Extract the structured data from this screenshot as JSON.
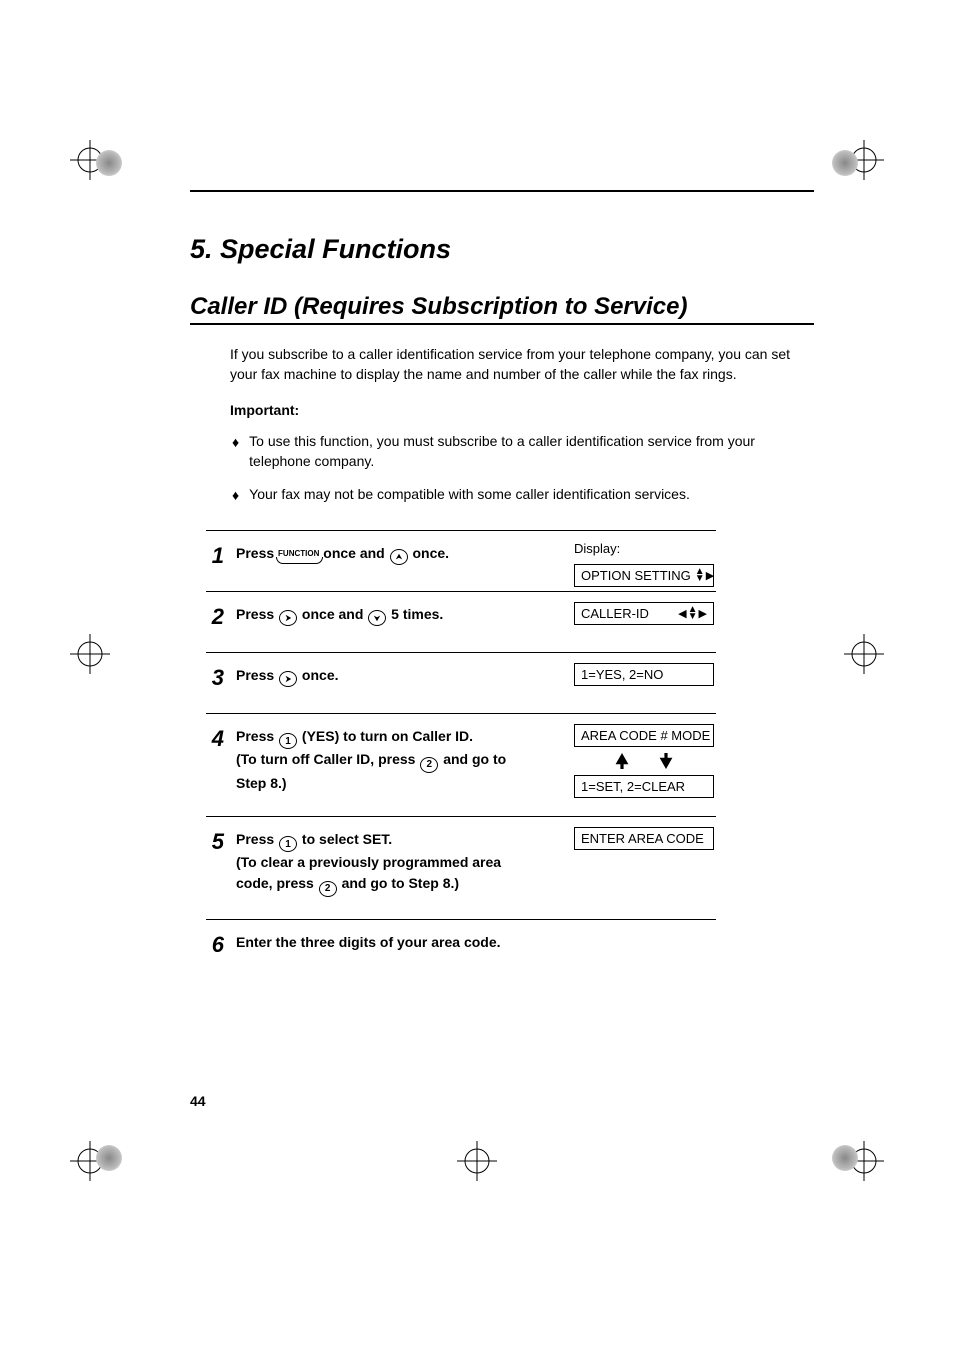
{
  "chapter": "5.  Special Functions",
  "section": "Caller ID (Requires Subscription to Service)",
  "intro": "If you subscribe to a caller identification service from your telephone company, you can set your fax machine to display the name and number of the caller while the fax rings.",
  "important_label": "Important:",
  "bullets": [
    "To use this function, you must subscribe to a caller identification service from your telephone company.",
    "Your fax may not be compatible with some caller identification services."
  ],
  "steps": [
    {
      "n": "1",
      "parts": [
        "Press ",
        "FUNCTION",
        " once and ",
        "UP_KEY",
        " once."
      ],
      "display_label": "Display:",
      "displays": [
        {
          "text": "OPTION SETTING",
          "arrows": "udr"
        }
      ]
    },
    {
      "n": "2",
      "parts": [
        "Press ",
        "RIGHT_KEY",
        " once and ",
        "DOWN_KEY",
        " 5 times."
      ],
      "displays": [
        {
          "text": "CALLER-ID",
          "arrows": "udlr"
        }
      ]
    },
    {
      "n": "3",
      "parts": [
        "Press ",
        "RIGHT_KEY",
        " once."
      ],
      "displays": [
        {
          "text": "1=YES, 2=NO"
        }
      ]
    },
    {
      "n": "4",
      "parts": [
        "Press ",
        "NUM1",
        " (YES) to turn on Caller ID.\n(To turn off Caller ID, press ",
        "NUM2",
        " and go to Step 8.)"
      ],
      "displays": [
        {
          "text": "AREA CODE # MODE"
        },
        {
          "big_arrows": true
        },
        {
          "text": "1=SET, 2=CLEAR"
        }
      ]
    },
    {
      "n": "5",
      "parts": [
        "Press ",
        "NUM1",
        " to select SET.\n(To clear a previously programmed area code, press ",
        "NUM2",
        " and go to Step 8.)"
      ],
      "displays": [
        {
          "text": "ENTER AREA CODE"
        }
      ]
    },
    {
      "n": "6",
      "parts": [
        "Enter the three digits of your area code."
      ]
    }
  ],
  "page_number": "44"
}
